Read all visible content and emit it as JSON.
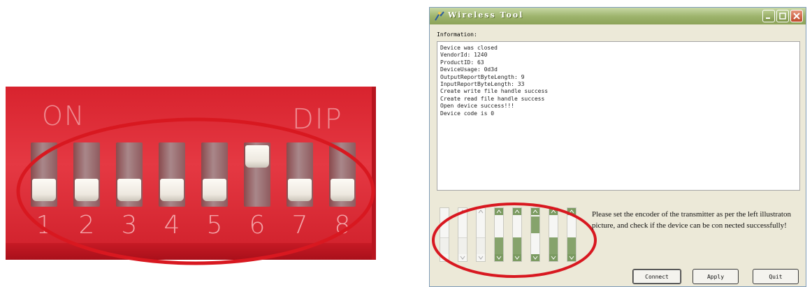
{
  "photo": {
    "label_left": "ON",
    "label_right": "DIP",
    "switch_numbers": [
      "1",
      "2",
      "3",
      "4",
      "5",
      "6",
      "7",
      "8"
    ],
    "switch_states": [
      "off",
      "off",
      "off",
      "off",
      "off",
      "on",
      "off",
      "off"
    ],
    "body_color": "#e0303a",
    "highlight_color": "#d81820"
  },
  "window": {
    "title": "Wireless Tool",
    "icon": "app-icon",
    "controls": {
      "minimize": "minimize-icon",
      "maximize": "maximize-icon",
      "close": "close-icon"
    },
    "info_label": "Information:",
    "log_lines": [
      "Device was closed",
      "VendorId: 1240",
      "ProductID: 63",
      "DeviceUsage: 0d3d",
      "OutputReportByteLength: 9",
      "InputReportByteLength: 33",
      "Create write file handle success",
      "Create read file handle success",
      "Open device success!!!",
      "Device code is 0"
    ],
    "encoder_switches": [
      "off",
      "off",
      "off",
      "on",
      "on",
      "on",
      "on",
      "on"
    ],
    "instructions": "Please set the encoder of the transmitter as per the left illustraton picture, and check if the device can be con nected successfully!",
    "buttons": {
      "connect": "Connect",
      "apply": "Apply",
      "quit": "Quit"
    },
    "accent_green": "#7b9b61"
  }
}
